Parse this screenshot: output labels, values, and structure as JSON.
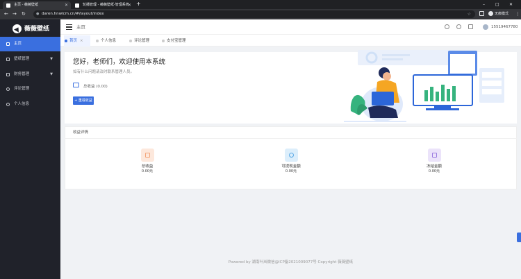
{
  "browser": {
    "tabs": [
      {
        "title": "主页 - 薇薇壁纸",
        "active": true
      },
      {
        "title": "轮播管理 - 薇薇壁纸-管理系统",
        "active": false
      }
    ],
    "new_tab": "+",
    "url": "daren.hnwlcm.cn/#/layout/index",
    "incognito_label": "无痕模式",
    "window_controls": [
      "–",
      "□",
      "✕"
    ]
  },
  "sidebar": {
    "logo_text": "薇薇壁纸",
    "items": [
      {
        "label": "主页",
        "icon": "home-icon",
        "active": true,
        "has_arrow": false
      },
      {
        "label": "壁纸管理",
        "icon": "picture-icon",
        "active": false,
        "has_arrow": true
      },
      {
        "label": "财务管理",
        "icon": "finance-icon",
        "active": false,
        "has_arrow": true
      },
      {
        "label": "评论管理",
        "icon": "comment-icon",
        "active": false,
        "has_arrow": false
      },
      {
        "label": "个人信息",
        "icon": "user-icon",
        "active": false,
        "has_arrow": false
      }
    ]
  },
  "header": {
    "breadcrumb": "主页",
    "username": "15519467780"
  },
  "page_tabs": [
    {
      "label": "首页",
      "active": true,
      "closable": true
    },
    {
      "label": "个人信息",
      "active": false,
      "closable": false
    },
    {
      "label": "评论管理",
      "active": false,
      "closable": false
    },
    {
      "label": "支付宝管理",
      "active": false,
      "closable": false
    }
  ],
  "welcome": {
    "title": "您好，老师们，欢迎使用本系统",
    "subtitle": "如有什么问题请及时联系管理人员。",
    "income_label": "总收益 (0.00)",
    "reload_button": "重载收益"
  },
  "income_details": {
    "title": "收益详情",
    "stats": [
      {
        "label": "总收益",
        "value": "0.00元",
        "color": "#f4a67a",
        "bg": "#fde8dc",
        "icon": "wallet-icon"
      },
      {
        "label": "可提现金额",
        "value": "0.00元",
        "color": "#5aa9e6",
        "bg": "#dceefb",
        "icon": "withdraw-icon"
      },
      {
        "label": "冻结金额",
        "value": "0.00元",
        "color": "#9b7be0",
        "bg": "#ebe3fa",
        "icon": "grid-icon"
      }
    ]
  },
  "footer": {
    "text": "Powered by 湖南叶岚微信@ICP备2021009077号  Copyright 薇薇壁纸"
  },
  "colors": {
    "accent": "#3a6fdf",
    "sidebar_bg": "#20222a"
  }
}
